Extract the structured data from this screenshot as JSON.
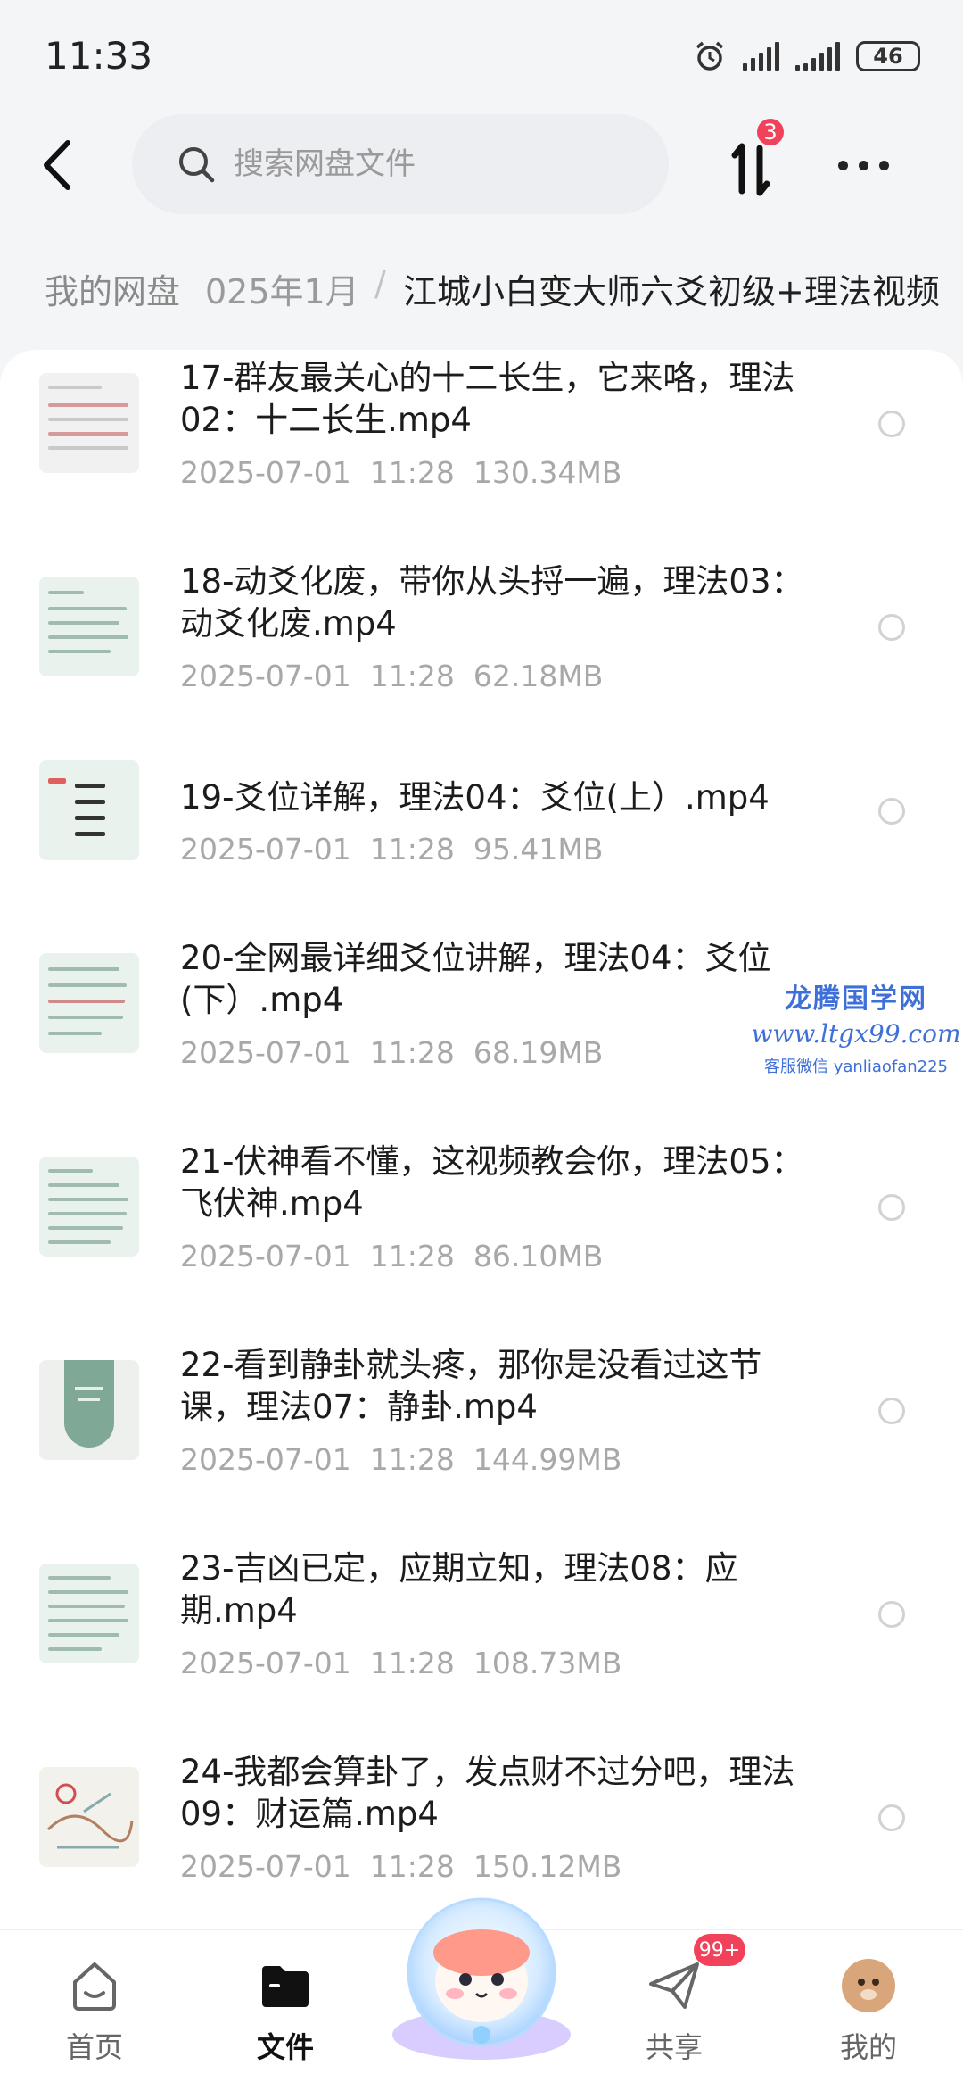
{
  "status": {
    "time": "11:33",
    "battery": "46"
  },
  "header": {
    "search_placeholder": "搜索网盘文件",
    "transfer_badge": "3"
  },
  "breadcrumb": {
    "root": "我的网盘",
    "mid": "025年1月",
    "separator": "/",
    "current": "江城小白变大师六爻初级+理法视频"
  },
  "files": [
    {
      "name": "17-群友最关心的十二长生，它来咯，理法02：十二长生.mp4",
      "date": "2025-07-01",
      "time": "11:28",
      "size": "130.34MB"
    },
    {
      "name": "18-动爻化废，带你从头捋一遍，理法03：动爻化废.mp4",
      "date": "2025-07-01",
      "time": "11:28",
      "size": "62.18MB"
    },
    {
      "name": "19-爻位详解，理法04：爻位(上）.mp4",
      "date": "2025-07-01",
      "time": "11:28",
      "size": "95.41MB"
    },
    {
      "name": "20-全网最详细爻位讲解，理法04：爻位(下）.mp4",
      "date": "2025-07-01",
      "time": "11:28",
      "size": "68.19MB"
    },
    {
      "name": "21-伏神看不懂，这视频教会你，理法05：飞伏神.mp4",
      "date": "2025-07-01",
      "time": "11:28",
      "size": "86.10MB"
    },
    {
      "name": "22-看到静卦就头疼，那你是没看过这节课，理法07：静卦.mp4",
      "date": "2025-07-01",
      "time": "11:28",
      "size": "144.99MB"
    },
    {
      "name": "23-吉凶已定，应期立知，理法08：应期.mp4",
      "date": "2025-07-01",
      "time": "11:28",
      "size": "108.73MB"
    },
    {
      "name": "24-我都会算卦了，发点财不过分吧，理法09：财运篇.mp4",
      "date": "2025-07-01",
      "time": "11:28",
      "size": "150.12MB"
    }
  ],
  "watermark": {
    "line1": "龙腾国学网",
    "line2": "www.ltgx99.com",
    "line3": "客服微信 yanliaofan225"
  },
  "nav": {
    "home": "首页",
    "files": "文件",
    "share": "共享",
    "share_badge": "99+",
    "mine": "我的"
  }
}
